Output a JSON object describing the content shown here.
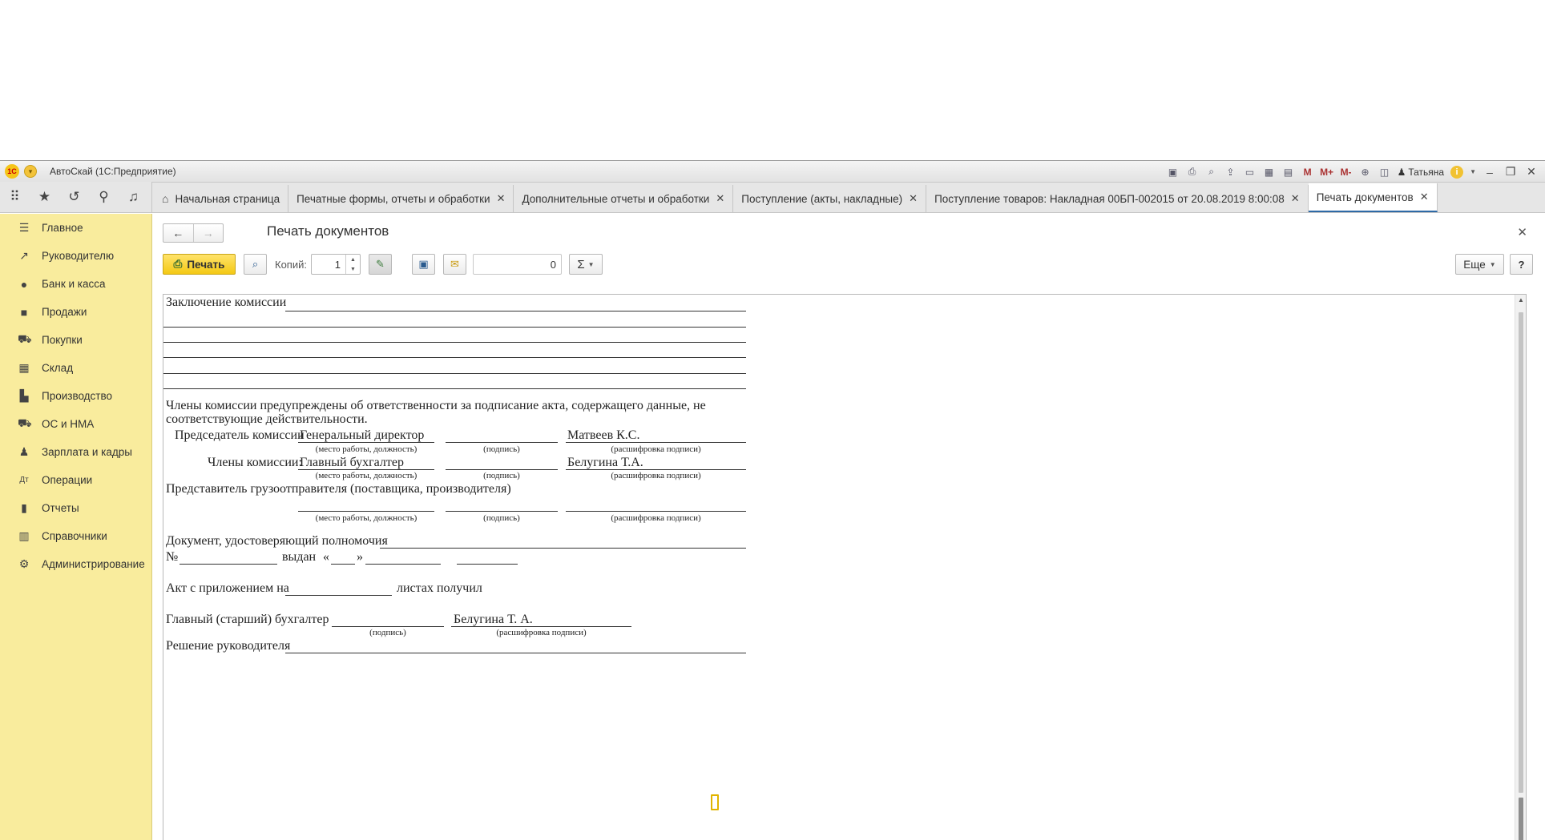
{
  "window": {
    "app_title": "АвтоСкай  (1С:Предприятие)",
    "user_name": "Татьяна",
    "toolbar_icons": [
      "save-icon",
      "print-icon",
      "preview-icon",
      "upload-icon",
      "doc-icon",
      "calculator-icon",
      "calendar-icon",
      "M",
      "M+",
      "M-",
      "zoom-icon",
      "panel-icon"
    ],
    "memory_labels": [
      "M",
      "M+",
      "M-"
    ]
  },
  "nav_icons": [
    "apps-grid-icon",
    "star-icon",
    "history-icon",
    "search-icon",
    "bell-icon"
  ],
  "tabs": [
    {
      "label": "Начальная страница",
      "closable": false,
      "home": true
    },
    {
      "label": "Печатные формы, отчеты и обработки",
      "closable": true
    },
    {
      "label": "Дополнительные отчеты и обработки",
      "closable": true
    },
    {
      "label": "Поступление (акты, накладные)",
      "closable": true
    },
    {
      "label": "Поступление товаров: Накладная 00БП-002015 от 20.08.2019 8:00:08",
      "closable": true
    },
    {
      "label": "Печать документов",
      "closable": true,
      "active": true
    }
  ],
  "sidebar": {
    "items": [
      {
        "label": "Главное",
        "icon": "menu-lines-icon"
      },
      {
        "label": "Руководителю",
        "icon": "trend-icon"
      },
      {
        "label": "Банк и касса",
        "icon": "coin-icon"
      },
      {
        "label": "Продажи",
        "icon": "bag-icon"
      },
      {
        "label": "Покупки",
        "icon": "cart-icon"
      },
      {
        "label": "Склад",
        "icon": "grid-icon"
      },
      {
        "label": "Производство",
        "icon": "factory-icon"
      },
      {
        "label": "ОС и НМА",
        "icon": "truck-icon"
      },
      {
        "label": "Зарплата и кадры",
        "icon": "person-icon"
      },
      {
        "label": "Операции",
        "icon": "dt-kt-icon"
      },
      {
        "label": "Отчеты",
        "icon": "bar-chart-icon"
      },
      {
        "label": "Справочники",
        "icon": "books-icon"
      },
      {
        "label": "Администрирование",
        "icon": "gear-icon"
      }
    ]
  },
  "form": {
    "title": "Печать документов",
    "print_label": "Печать",
    "copies_label": "Копий:",
    "copies_value": "1",
    "sum_value": "0",
    "sum_symbol": "Σ",
    "more_label": "Еще",
    "help_label": "?"
  },
  "document": {
    "commission_conclusion": "Заключение комиссии",
    "warning_line1": "Члены комиссии предупреждены об ответственности за подписание акта, содержащего данные, не",
    "warning_line2": "соответствующие действительности.",
    "chairman_label": "Председатель комиссии",
    "chairman_position": "Генеральный директор",
    "chairman_name": "Матвеев К.С.",
    "members_label": "Члены комиссии:",
    "member_position": "Главный бухгалтер",
    "member_name": "Белугина Т.А.",
    "caption_position": "(место работы, должность)",
    "caption_signature": "(подпись)",
    "caption_decode": "(расшифровка подписи)",
    "shipper_rep": "Представитель грузоотправителя (поставщика, производителя)",
    "authority_doc": "Документ, удостоверяющий полномочия",
    "number_sign": "№",
    "issued": "выдан",
    "quote_open": "«",
    "quote_close": "»",
    "act_attached": "Акт с приложением на",
    "sheets_received": "листах получил",
    "chief_accountant": "Главный (старший) бухгалтер",
    "chief_accountant_name": "Белугина Т. А.",
    "manager_decision": "Решение руководителя"
  }
}
